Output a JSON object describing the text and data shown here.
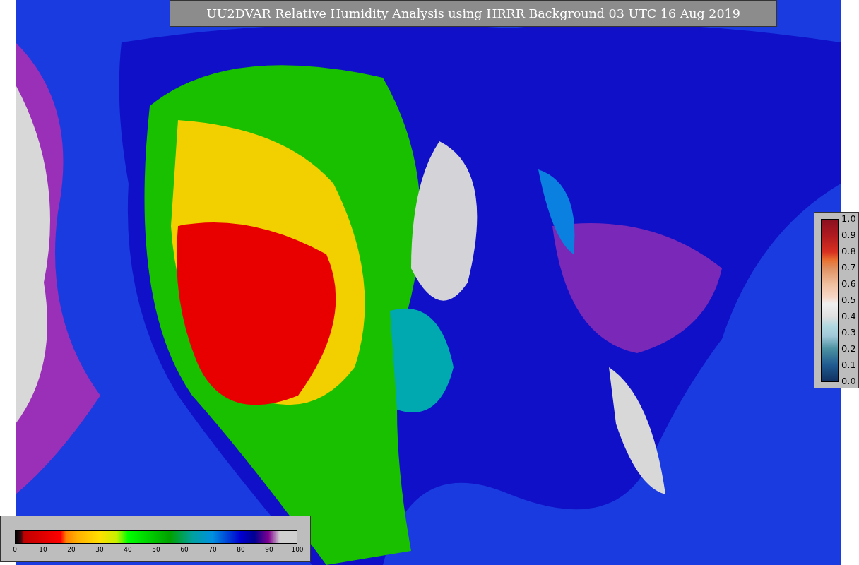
{
  "title": "UU2DVAR Relative Humidity Analysis using HRRR Background 03 UTC 16 Aug 2019",
  "humidity_colorbar": {
    "ticks": [
      "0",
      "10",
      "20",
      "30",
      "40",
      "50",
      "60",
      "70",
      "80",
      "90",
      "100"
    ]
  },
  "ratio_colorbar": {
    "ticks": [
      "1.0",
      "0.9",
      "0.8",
      "0.7",
      "0.6",
      "0.5",
      "0.4",
      "0.3",
      "0.2",
      "0.1",
      "0.0"
    ]
  }
}
